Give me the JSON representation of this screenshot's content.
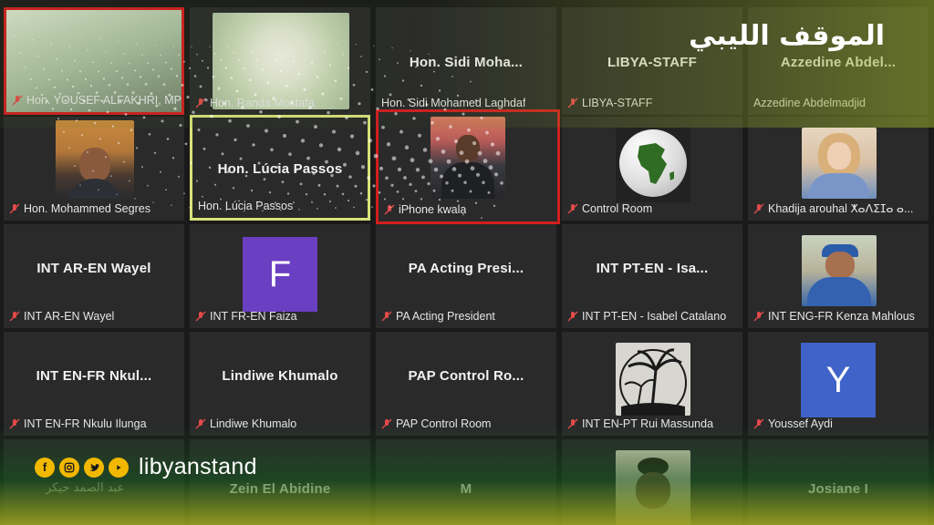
{
  "logo_arabic": "الموقف الليبي",
  "brand": {
    "handle": "libyanstand",
    "icons": [
      "facebook-icon",
      "instagram-icon",
      "twitter-icon",
      "youtube-icon"
    ]
  },
  "colors": {
    "active_speaker": "#d11f1f",
    "highlight": "#d8e27a",
    "tile_bg": "#2a2a2a",
    "brand_yellow": "#f2b800"
  },
  "row1": [
    {
      "label": "Hon. YOUSEF ALFAKHRI, MP"
    },
    {
      "label": "Hon. Randa Mostafa"
    },
    {
      "title": "Hon. Sidi Moha...",
      "label": "Hon. Sidi Mohamed Laghdaf"
    },
    {
      "title": "LIBYA-STAFF",
      "label": "LIBYA-STAFF"
    },
    {
      "title": "Azzedine Abdel...",
      "label": "Azzedine Abdelmadjid"
    }
  ],
  "row2": [
    {
      "label": "Hon. Mohammed Segres"
    },
    {
      "title": "Hon. Lúcia Passos",
      "label": "Hon. Lúcia Passos"
    },
    {
      "label": "iPhone kwala"
    },
    {
      "label": "Control Room"
    },
    {
      "label": "Khadija arouhal ⵅⴰⴷⵉⵊⴰ ⴰ..."
    }
  ],
  "row3": [
    {
      "title": "INT AR-EN Wayel",
      "label": "INT AR-EN Wayel"
    },
    {
      "avatar": "F",
      "label": "INT FR-EN Faiza"
    },
    {
      "title": "PA Acting Presi...",
      "label": "PA Acting President"
    },
    {
      "title": "INT PT-EN - Isa...",
      "label": "INT PT-EN - Isabel Catalano"
    },
    {
      "label": "INT ENG-FR Kenza Mahlous"
    }
  ],
  "row4": [
    {
      "title": "INT EN-FR Nkul...",
      "label": "INT EN-FR Nkulu Ilunga"
    },
    {
      "title": "Lindiwe Khumalo",
      "label": "Lindiwe Khumalo"
    },
    {
      "title": "PAP Control Ro...",
      "label": "PAP Control Room"
    },
    {
      "label": "INT EN-PT Rui Massunda"
    },
    {
      "avatar": "Y",
      "label": "Youssef Aydi"
    }
  ],
  "row5": [
    {
      "title": "عبد الصمد حيكر"
    },
    {
      "title": "Zein El Abidine"
    },
    {
      "title": "M"
    },
    {
      "title": ""
    },
    {
      "title": "Josiane I"
    }
  ]
}
